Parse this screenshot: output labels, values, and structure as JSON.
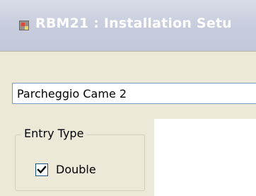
{
  "window": {
    "title": "RBM21 : Installation Setu",
    "icon": "app-icon"
  },
  "form": {
    "name_value": "Parcheggio Came 2",
    "entry_type": {
      "legend": "Entry Type",
      "double_label": "Double",
      "double_checked": true
    }
  },
  "colors": {
    "title_bar": "#c9cede",
    "client_bg": "#ece9d8",
    "field_border": "#7f9db9",
    "checkbox_border": "#1c5180"
  }
}
